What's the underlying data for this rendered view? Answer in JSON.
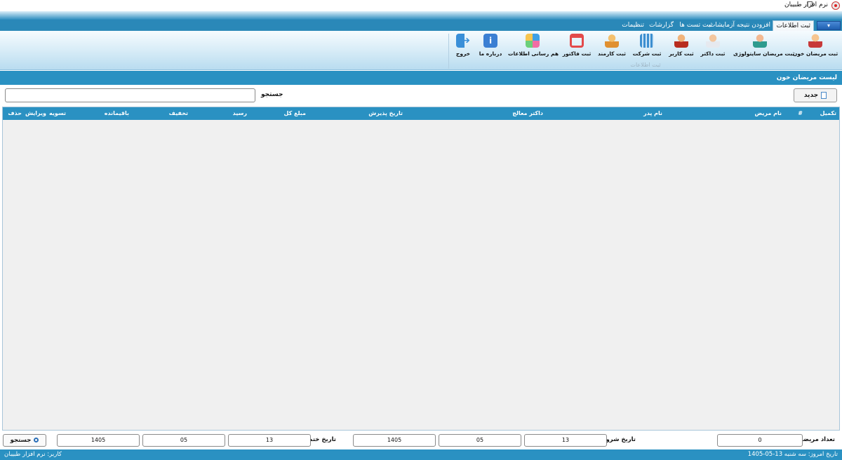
{
  "window": {
    "title": "نرم افزار طبیبان",
    "restore_icon": "❐"
  },
  "ribbon": {
    "file_button": "▾",
    "tabs": [
      "ثبت اطلاعات",
      "افزودن نتیجه آزمایشات",
      "ثبت تست ها",
      "گزارشات",
      "تنظیمات"
    ],
    "group_label": "ثبت اطلاعات",
    "buttons": [
      {
        "label": "ثبت مریضان خون",
        "icon": "patient-icon"
      },
      {
        "label": "ثبت مریضان سایتولوژی",
        "icon": "doctor-lab-icon"
      },
      {
        "label": "ثبت داکتر",
        "icon": "doctor-icon"
      },
      {
        "label": "ثبت کاربر",
        "icon": "user-icon"
      },
      {
        "label": "ثبت شرکت",
        "icon": "company-icon"
      },
      {
        "label": "ثبت کارمند",
        "icon": "staff-icon"
      },
      {
        "label": "ثبت فاکتور",
        "icon": "cart-icon"
      },
      {
        "label": "هم رسانی اطلاعات",
        "icon": "sync-icon"
      },
      {
        "label": "درباره ما",
        "icon": "info-icon",
        "glyph": "i"
      },
      {
        "label": "خروج",
        "icon": "exit-icon",
        "glyph": "➔"
      }
    ]
  },
  "section": {
    "title": "لیست مریضان خون"
  },
  "toolbar": {
    "new_label": "جدید",
    "search_label": "جستجو",
    "search_value": ""
  },
  "grid": {
    "columns": [
      "تکمیل",
      "#",
      "نام مریض",
      "نام پدر",
      "داکتر معالج",
      "تاریخ پذیرش",
      "مبلغ کل",
      "رسید",
      "تخفیف",
      "باقیمانده",
      "تسویه",
      "ویرایش",
      "حذف"
    ],
    "rows": []
  },
  "footer": {
    "patient_count_label": "تعداد مریضان",
    "patient_count": "0",
    "start_date_label": "تاریخ شروع",
    "start_date": {
      "day": "13",
      "month": "05",
      "year": "1405"
    },
    "end_date_label": "تاریخ ختم",
    "end_date": {
      "day": "13",
      "month": "05",
      "year": "1405"
    },
    "search_button": "جستجو"
  },
  "status": {
    "user": "کاربر: نرم افزار طبیبان",
    "today": "تاریخ امروز: سه شنبه  13-05-1405"
  }
}
